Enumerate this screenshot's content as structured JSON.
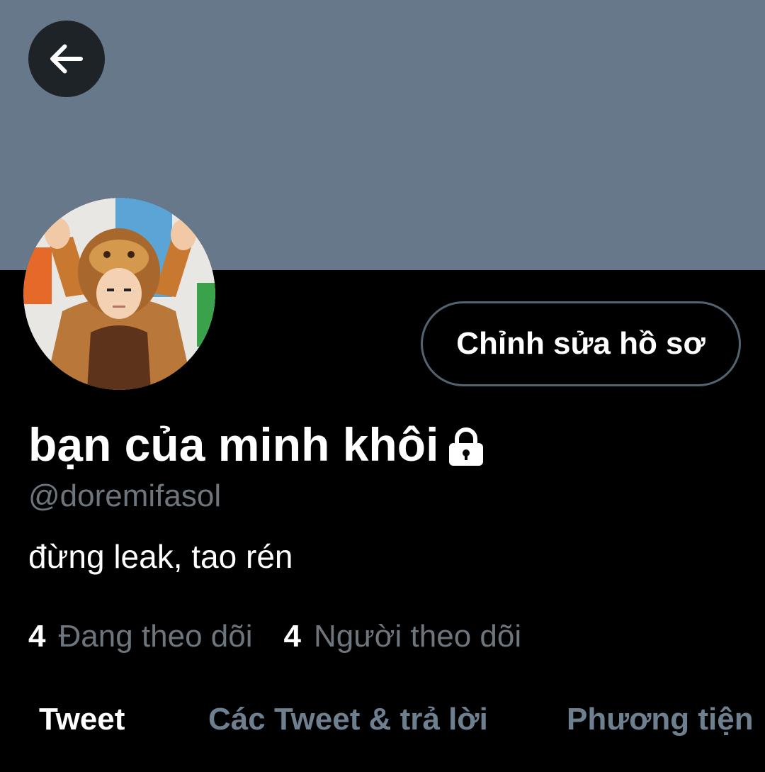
{
  "profile": {
    "display_name": "bạn của minh khôi",
    "handle": "@doremifasol",
    "bio": "đừng leak, tao rén",
    "edit_button_label": "Chỉnh sửa hồ sơ",
    "protected": true
  },
  "stats": {
    "following_count": "4",
    "following_label": "Đang theo dõi",
    "followers_count": "4",
    "followers_label": "Người theo dõi"
  },
  "tabs": [
    {
      "label": "Tweet",
      "active": true
    },
    {
      "label": "Các Tweet & trả lời",
      "active": false
    },
    {
      "label": "Phương tiện",
      "active": false
    }
  ],
  "colors": {
    "banner": "#66788a",
    "background": "#000000",
    "secondary_text": "#6e767d",
    "button_border": "#536471"
  },
  "icons": {
    "back": "arrow-left-icon",
    "protected": "lock-icon"
  }
}
